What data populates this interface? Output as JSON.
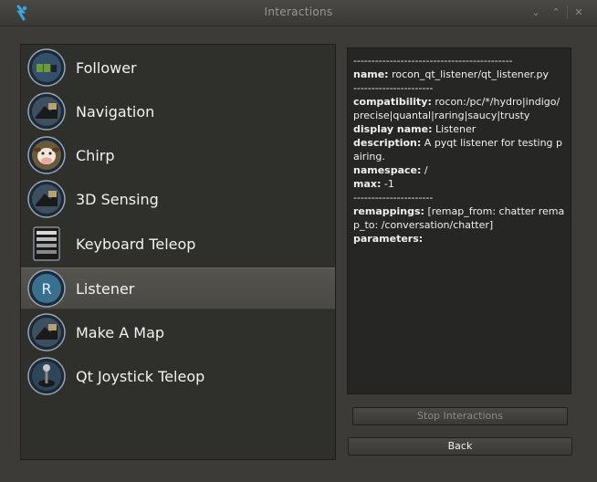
{
  "window": {
    "title": "Interactions"
  },
  "interactions": [
    {
      "label": "Follower",
      "icon": "turtlebot-follower-icon"
    },
    {
      "label": "Navigation",
      "icon": "turtlebot-navigation-icon"
    },
    {
      "label": "Chirp",
      "icon": "cow-chirp-icon"
    },
    {
      "label": "3D Sensing",
      "icon": "turtlebot-3d-sensing-icon"
    },
    {
      "label": "Keyboard Teleop",
      "icon": "keyboard-icon"
    },
    {
      "label": "Listener",
      "icon": "ros-listener-icon",
      "selected": true
    },
    {
      "label": "Make A Map",
      "icon": "turtlebot-map-icon"
    },
    {
      "label": "Qt Joystick Teleop",
      "icon": "joystick-icon"
    }
  ],
  "details": {
    "rule1": "--------------------------------------------",
    "name_key": "name:",
    "name_val": " rocon_qt_listener/qt_listener.py",
    "rule2": "----------------------",
    "compat_key": "compatibility:",
    "compat_val": " rocon:/pc/*/hydro|indigo/precise|quantal|raring|saucy|trusty",
    "display_key": "display name:",
    "display_val": " Listener",
    "desc_key": "description:",
    "desc_val": " A pyqt listener for testing pairing.",
    "ns_key": "namespace:",
    "ns_val": " /",
    "max_key": "max:",
    "max_val": " -1",
    "rule3": "----------------------",
    "remap_key": "remappings:",
    "remap_val": " [remap_from: chatter remap_to: /conversation/chatter]",
    "params_key": "parameters:"
  },
  "buttons": {
    "stop": "Stop Interactions",
    "back": "Back"
  },
  "colors": {
    "background": "#3c3b37",
    "selection": "#55544f",
    "list_bg": "#2f2f2c",
    "details_bg": "#262624"
  }
}
